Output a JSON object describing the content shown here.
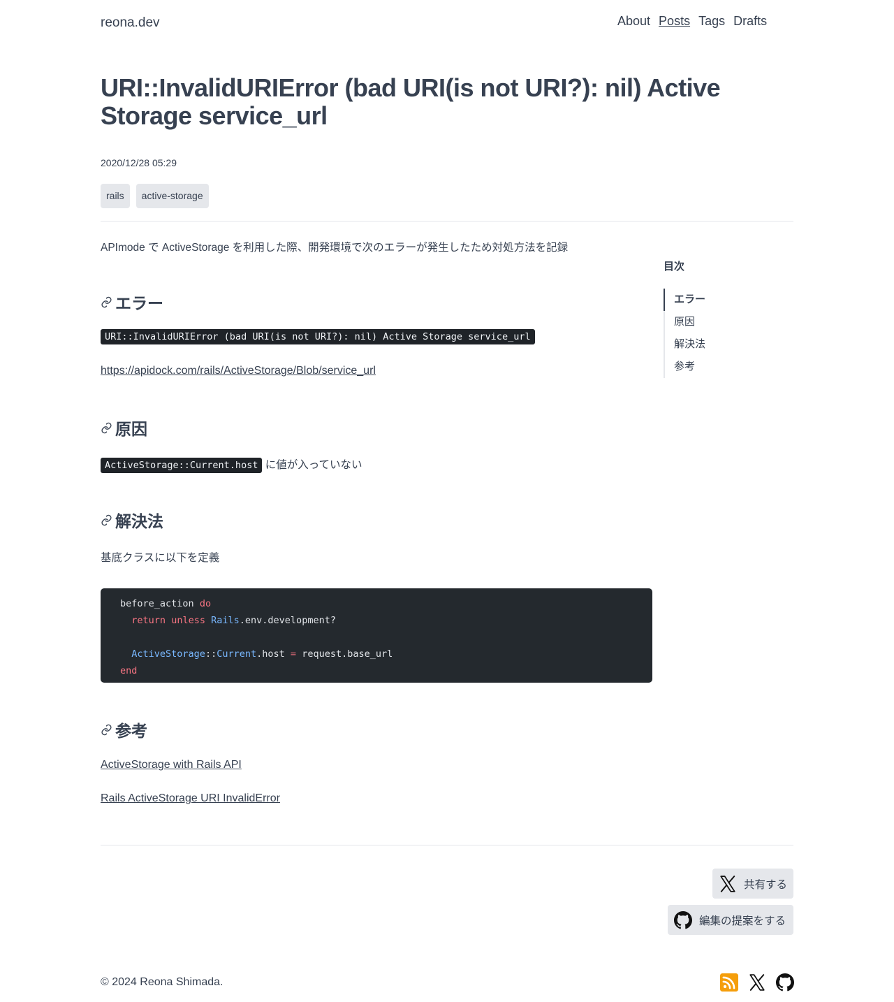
{
  "header": {
    "site_title": "reona.dev",
    "nav": [
      "About",
      "Posts",
      "Tags",
      "Drafts"
    ],
    "active_nav": "Posts"
  },
  "post": {
    "title": "URI::InvalidURIError (bad URI(is not URI?): nil) Active Storage service_url",
    "date": "2020/12/28 05:29",
    "tags": [
      "rails",
      "active-storage"
    ],
    "intro": "APImode で ActiveStorage を利用した際、開発環境で次のエラーが発生したため対処方法を記録",
    "sections": {
      "error": {
        "heading": "エラー",
        "code": "URI::InvalidURIError (bad URI(is not URI?): nil) Active Storage service_url",
        "link": "https://apidock.com/rails/ActiveStorage/Blob/service_url"
      },
      "cause": {
        "heading": "原因",
        "code": "ActiveStorage::Current.host",
        "text": "に値が入っていない"
      },
      "solution": {
        "heading": "解決法",
        "text": "基底クラスに以下を定義",
        "code_lines": [
          "before_action do",
          "  return unless Rails.env.development?",
          "",
          "  ActiveStorage::Current.host = request.base_url",
          "end"
        ]
      },
      "references": {
        "heading": "参考",
        "links": [
          "ActiveStorage with Rails API",
          "Rails ActiveStorage URI InvalidError"
        ]
      }
    }
  },
  "toc": {
    "title": "目次",
    "items": [
      "エラー",
      "原因",
      "解決法",
      "参考"
    ],
    "active": "エラー"
  },
  "share": {
    "x_label": "共有する",
    "github_label": "編集の提案をする"
  },
  "footer": {
    "copyright": "© 2024 Reona Shimada.",
    "icons": [
      "rss-icon",
      "x-icon",
      "github-icon"
    ],
    "rss_color": "#f59e0b"
  }
}
